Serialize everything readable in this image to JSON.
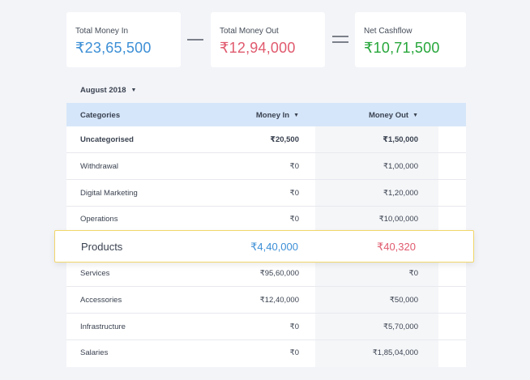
{
  "summary": {
    "money_in": {
      "label": "Total Money In",
      "value": "₹23,65,500"
    },
    "money_out": {
      "label": "Total Money Out",
      "value": "₹12,94,000"
    },
    "net": {
      "label": "Net Cashflow",
      "value": "₹10,71,500"
    }
  },
  "filter": {
    "month": "August 2018"
  },
  "table": {
    "headers": {
      "category": "Categories",
      "money_in": "Money In",
      "money_out": "Money Out"
    },
    "rows": [
      {
        "category": "Uncategorised",
        "money_in": "₹20,500",
        "money_out": "₹1,50,000"
      },
      {
        "category": "Withdrawal",
        "money_in": "₹0",
        "money_out": "₹1,00,000"
      },
      {
        "category": "Digital Marketing",
        "money_in": "₹0",
        "money_out": "₹1,20,000"
      },
      {
        "category": "Operations",
        "money_in": "₹0",
        "money_out": "₹10,00,000"
      },
      {
        "category": "Services",
        "money_in": "₹95,60,000",
        "money_out": "₹0"
      },
      {
        "category": "Accessories",
        "money_in": "₹12,40,000",
        "money_out": "₹50,000"
      },
      {
        "category": "Infrastructure",
        "money_in": "₹0",
        "money_out": "₹5,70,000"
      },
      {
        "category": "Salaries",
        "money_in": "₹0",
        "money_out": "₹1,85,04,000"
      }
    ],
    "highlighted": {
      "category": "Products",
      "money_in": "₹4,40,000",
      "money_out": "₹40,320"
    }
  },
  "colors": {
    "money_in": "#3c8fd6",
    "money_out": "#e05a6e",
    "net": "#26a63a",
    "header_bg": "#d6e6fa",
    "highlight_border": "#f1d66a"
  },
  "icons": {
    "sort": "caret-down-icon",
    "operators": [
      "minus-icon",
      "equals-icon"
    ]
  }
}
